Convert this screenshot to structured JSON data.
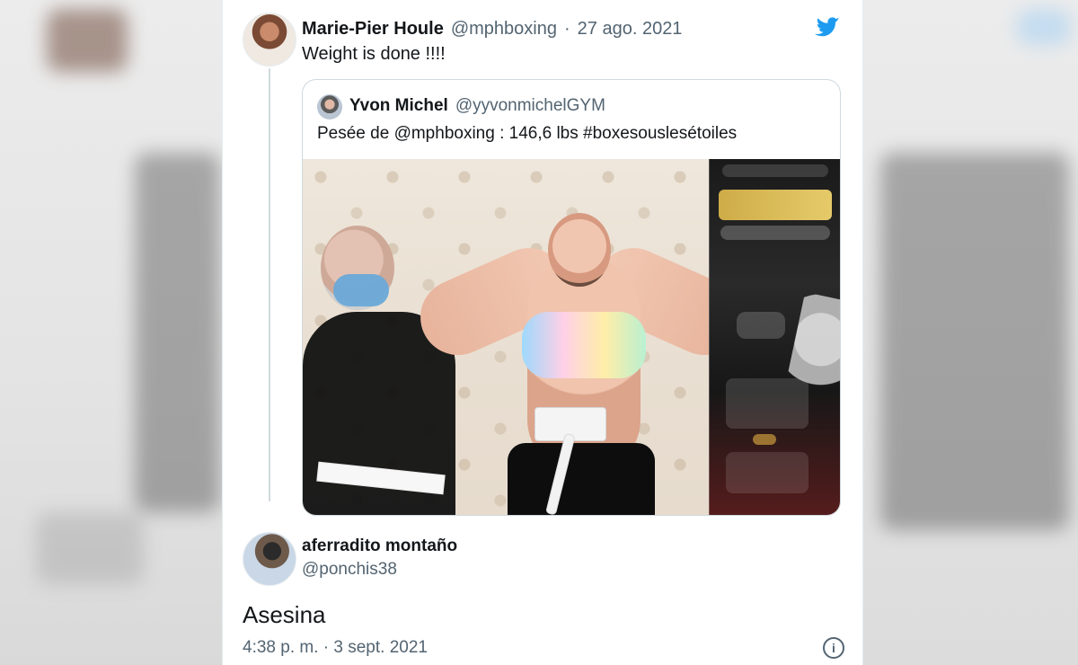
{
  "colors": {
    "twitter_blue": "#1d9bf0",
    "text_primary": "#14171a",
    "text_secondary": "#536471",
    "border": "#cfd9de"
  },
  "tweet": {
    "author": {
      "name": "Marie-Pier Houle",
      "handle": "@mphboxing",
      "date": "27 ago. 2021"
    },
    "separator": "·",
    "text": "Weight is done !!!!"
  },
  "quoted_tweet": {
    "author": {
      "name": "Yvon Michel",
      "handle": "@yyvonmichelGYM"
    },
    "text": "Pesée de @mphboxing : 146,6 lbs #boxesouslesétoiles"
  },
  "reply": {
    "author": {
      "name": "aferradito montaño",
      "handle": "@ponchis38"
    },
    "text": "Asesina",
    "timestamp": "4:38 p. m. · 3 sept. 2021",
    "info_icon": "info-icon"
  },
  "icons": {
    "brand": "twitter-bird-icon"
  }
}
